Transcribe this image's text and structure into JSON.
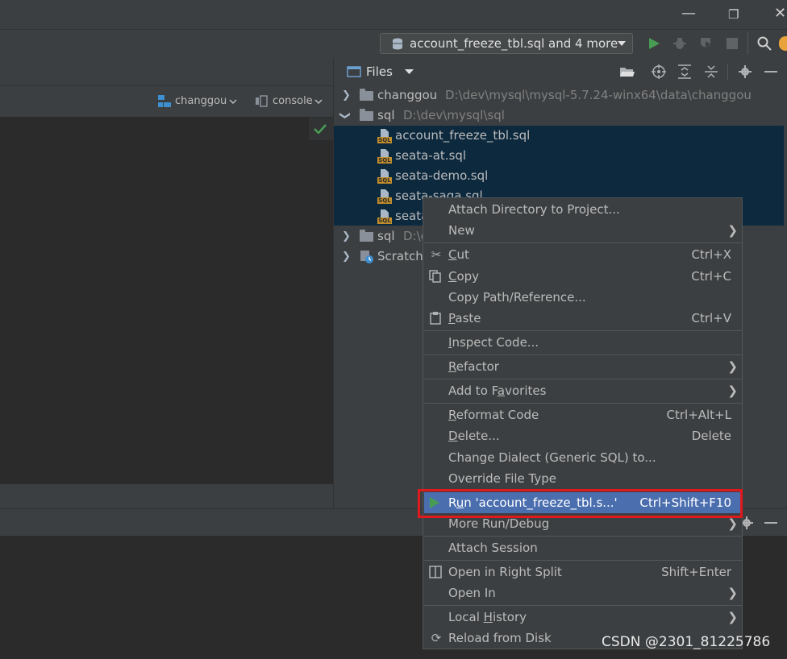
{
  "window": {
    "minimize_glyph": "—",
    "restore_glyph": "❐",
    "close_glyph": "✕"
  },
  "toolbar": {
    "run_config": "account_freeze_tbl.sql and 4 more",
    "colors": {
      "run": "#499c54",
      "accent_orange": "#e8a33d"
    }
  },
  "editor": {
    "datasource": "changgou",
    "session": "console"
  },
  "files_panel": {
    "view_label": "Files",
    "tree": [
      {
        "name": "changgou",
        "path": "D:\\dev\\mysql\\mysql-5.7.24-winx64\\data\\changgou",
        "expanded": false,
        "type": "folder"
      },
      {
        "name": "sql",
        "path": "D:\\dev\\mysql\\sql",
        "expanded": true,
        "type": "folder"
      },
      {
        "name": "account_freeze_tbl.sql",
        "type": "sql",
        "selected": true
      },
      {
        "name": "seata-at.sql",
        "type": "sql",
        "selected": true
      },
      {
        "name": "seata-demo.sql",
        "type": "sql",
        "selected": true
      },
      {
        "name": "seata-saga.sql",
        "type": "sql",
        "selected": true
      },
      {
        "name": "seata",
        "type": "sql",
        "selected": true
      },
      {
        "name": "sql",
        "path": "D:\\c",
        "expanded": false,
        "type": "folder"
      },
      {
        "name": "Scratche",
        "expanded": false,
        "type": "scratch"
      }
    ]
  },
  "context_menu": {
    "items": [
      {
        "label": "Attach Directory to Project...",
        "shortcut": ""
      },
      {
        "label": "New",
        "shortcut": "",
        "submenu": true
      },
      {
        "label": "Cut",
        "shortcut": "Ctrl+X",
        "icon": "scissors-icon"
      },
      {
        "label": "Copy",
        "shortcut": "Ctrl+C",
        "icon": "copy-icon"
      },
      {
        "label": "Copy Path/Reference...",
        "shortcut": ""
      },
      {
        "label": "Paste",
        "shortcut": "Ctrl+V",
        "icon": "paste-icon"
      },
      {
        "label": "Inspect Code...",
        "shortcut": ""
      },
      {
        "label": "Refactor",
        "shortcut": "",
        "submenu": true
      },
      {
        "label": "Add to Favorites",
        "shortcut": "",
        "submenu": true
      },
      {
        "label": "Reformat Code",
        "shortcut": "Ctrl+Alt+L"
      },
      {
        "label": "Delete...",
        "shortcut": "Delete"
      },
      {
        "label": "Change Dialect (Generic SQL) to...",
        "shortcut": ""
      },
      {
        "label": "Override File Type",
        "shortcut": ""
      },
      {
        "label": "Run 'account_freeze_tbl.s...'",
        "shortcut": "Ctrl+Shift+F10",
        "icon": "run-icon",
        "highlighted": true
      },
      {
        "label": "More Run/Debug",
        "shortcut": "",
        "submenu": true
      },
      {
        "label": "Attach Session",
        "shortcut": ""
      },
      {
        "label": "Open in Right Split",
        "shortcut": "Shift+Enter",
        "icon": "split-icon"
      },
      {
        "label": "Open In",
        "shortcut": "",
        "submenu": true
      },
      {
        "label": "Local History",
        "shortcut": "",
        "submenu": true
      },
      {
        "label": "Reload from Disk",
        "shortcut": "",
        "icon": "reload-icon"
      }
    ]
  },
  "watermark": "CSDN @2301_81225786"
}
